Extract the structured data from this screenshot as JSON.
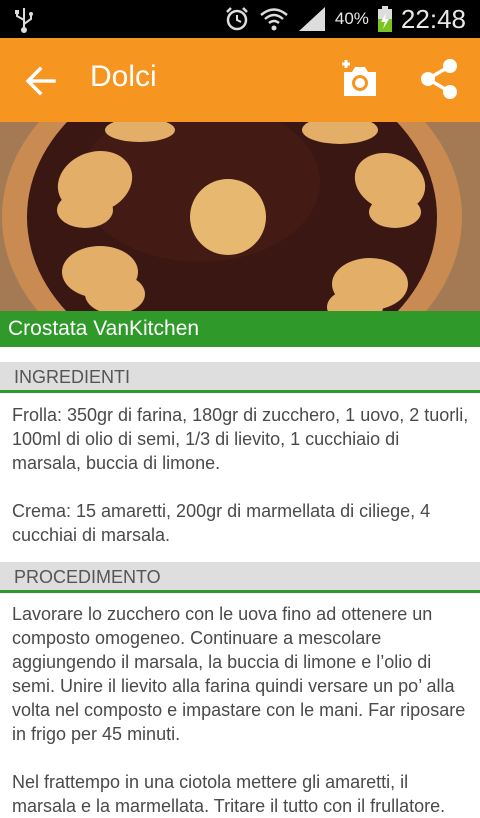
{
  "status_bar": {
    "battery_percent": "40%",
    "time": "22:48",
    "icons": [
      "usb-icon",
      "alarm-icon",
      "wifi-icon",
      "signal-icon",
      "battery-icon"
    ]
  },
  "app_bar": {
    "title": "Dolci",
    "icons": [
      "back-arrow-icon",
      "add-photo-icon",
      "share-icon"
    ],
    "color": "#f6951f"
  },
  "hero": {
    "caption": "Crostata VanKitchen",
    "caption_color": "#2f9a2a"
  },
  "sections": {
    "ingredients": {
      "header": "INGREDIENTI",
      "paragraphs": [
        "Frolla: 350gr di farina, 180gr di zucchero, 1 uovo, 2 tuorli, 100ml di olio di semi, 1/3 di lievito, 1 cucchiaio di marsala, buccia di limone.",
        "Crema: 15 amaretti, 200gr di marmellata di ciliege, 4 cucchiai di marsala."
      ]
    },
    "procedure": {
      "header": "PROCEDIMENTO",
      "paragraphs": [
        "Lavorare lo zucchero con le uova fino ad ottenere un composto omogeneo. Continuare a mescolare aggiungendo il marsala, la buccia di limone e l’olio di semi. Unire il lievito alla farina quindi versare un po’ alla volta nel composto e impastare con le mani. Far riposare in frigo per 45 minuti.",
        "Nel frattempo in una ciotola mettere gli amaretti, il marsala e la marmellata. Tritare il tutto con il frullatore."
      ]
    }
  }
}
